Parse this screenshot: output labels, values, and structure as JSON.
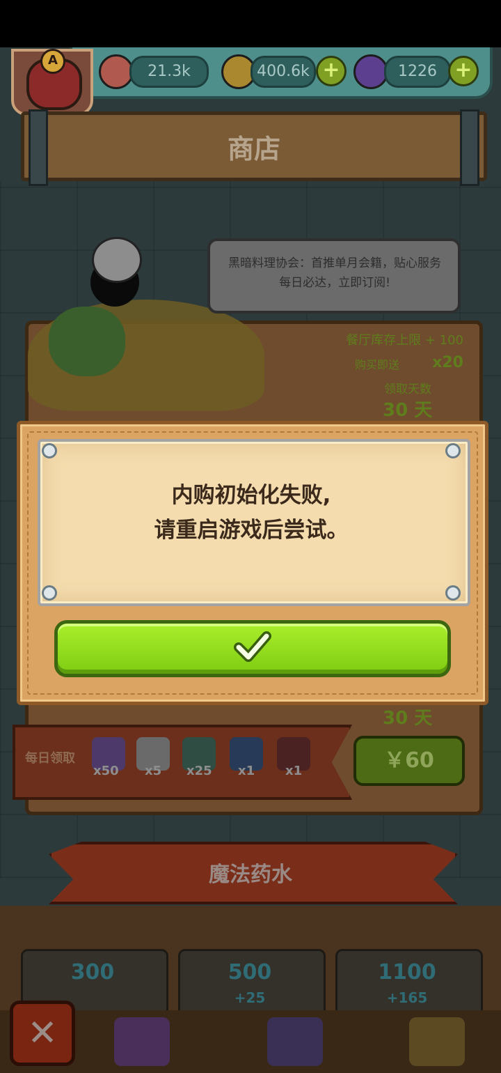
{
  "topbar": {
    "avatar_badge": "A",
    "eyeballs": "21.3k",
    "coins": "400.6k",
    "potions": "1226",
    "plus_symbol": "+"
  },
  "shop": {
    "title": "商店",
    "speech": "黑暗料理协会：首推单月会籍，贴心服务每日必达，立即订阅!",
    "restaurant_limit": "餐厅库存上限 + 100",
    "buy_bonus_label": "购买即送",
    "buy_bonus_qty": "x20",
    "claim_days_label": "领取天数",
    "claim_days_top": "30 天",
    "claim_days_bottom": "30 天",
    "daily_label": "每日领取",
    "daily_items": [
      {
        "icon": "potion-icon",
        "qty": "x50"
      },
      {
        "icon": "ticket-icon",
        "qty": "x5"
      },
      {
        "icon": "card-icon",
        "qty": "x25"
      },
      {
        "icon": "card-icon",
        "qty": "x1"
      },
      {
        "icon": "card-icon",
        "qty": "x1"
      }
    ],
    "price": "￥60",
    "potion_section_title": "魔法药水",
    "packs": [
      {
        "amount": "300",
        "bonus": ""
      },
      {
        "amount": "500",
        "bonus": "+25"
      },
      {
        "amount": "1100",
        "bonus": "+165"
      }
    ]
  },
  "modal": {
    "line1": "内购初始化失败,",
    "line2": "请重启游戏后尝试。",
    "confirm_icon": "checkmark-icon"
  },
  "nav": {
    "close_symbol": "✕"
  },
  "colors": {
    "confirm_green": "#8fdc1a",
    "frame_wood": "#dba462",
    "paper": "#f4dcae",
    "text_dark": "#3b2a1c"
  }
}
